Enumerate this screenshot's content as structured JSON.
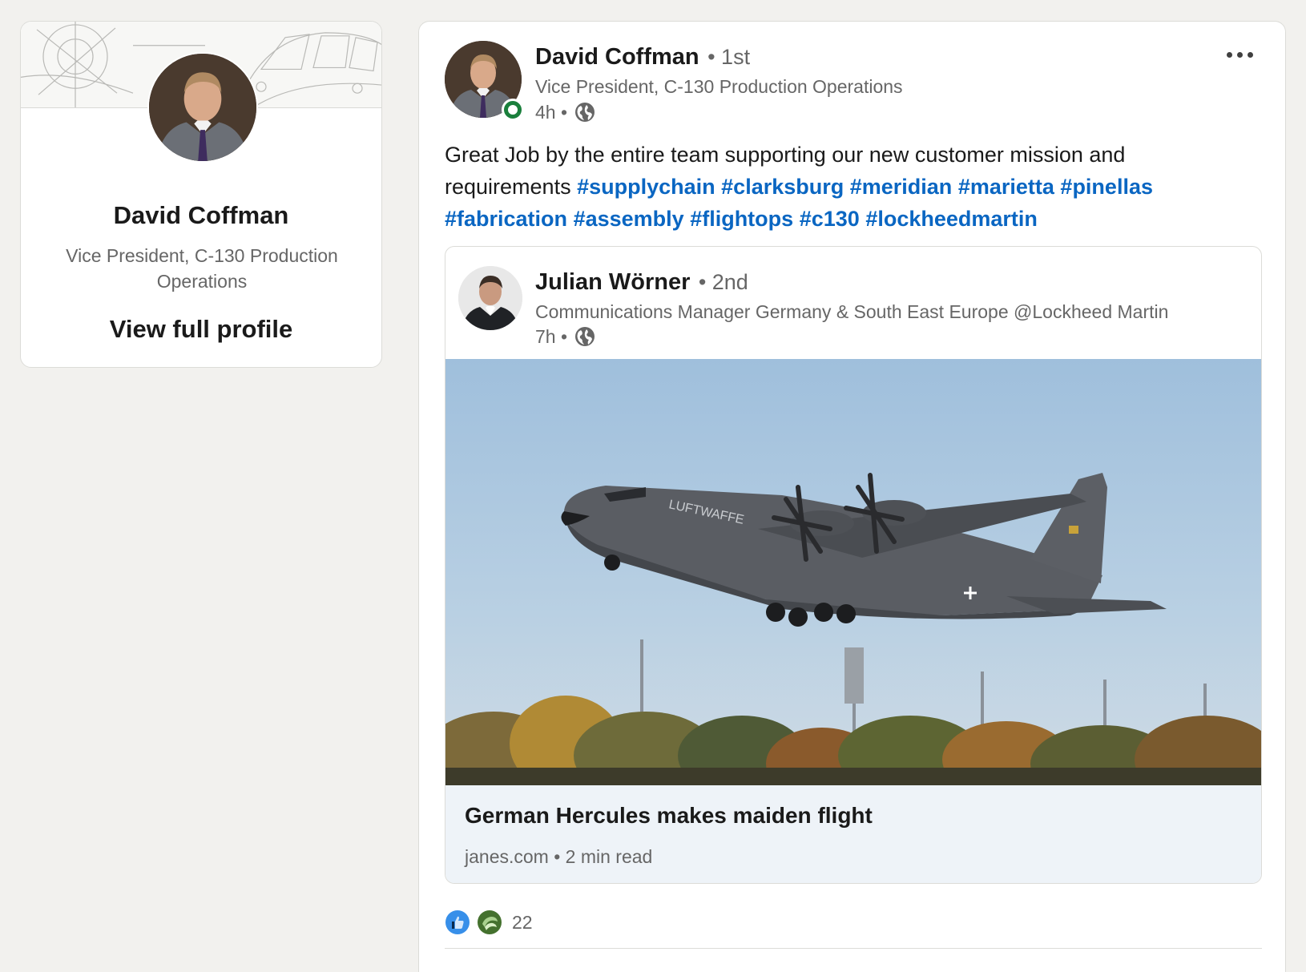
{
  "profile_card": {
    "name": "David Coffman",
    "headline": "Vice President, C-130 Production Operations",
    "view_profile_label": "View full profile"
  },
  "post": {
    "author": {
      "name": "David Coffman",
      "degree": "• 1st",
      "headline": "Vice President, C-130 Production Operations",
      "time": "4h •",
      "status": "online"
    },
    "more_icon": "more-horizontal-icon",
    "text": "Great Job by the entire team supporting our new customer mission and requirements",
    "hashtags": [
      "#supplychain",
      "#clarksburg",
      "#meridian",
      "#marietta",
      "#pinellas",
      "#fabrication",
      "#assembly",
      "#flightops",
      "#c130",
      "#lockheedmartin"
    ],
    "shared": {
      "author": {
        "name": "Julian Wörner",
        "degree": "• 2nd",
        "headline": "Communications Manager Germany & South East Europe @Lockheed Martin",
        "time": "7h •"
      },
      "image_text": "LUFTWAFFE",
      "article": {
        "title": "German Hercules makes maiden flight",
        "source": "janes.com • 2 min read"
      }
    },
    "reactions": {
      "icons": [
        "like-icon",
        "support-icon"
      ],
      "count": "22"
    }
  },
  "colors": {
    "page_background": "#f2f1ee",
    "link": "#0a66c2",
    "online_status": "#1a7f3c",
    "article_footer": "#eef3f8"
  }
}
